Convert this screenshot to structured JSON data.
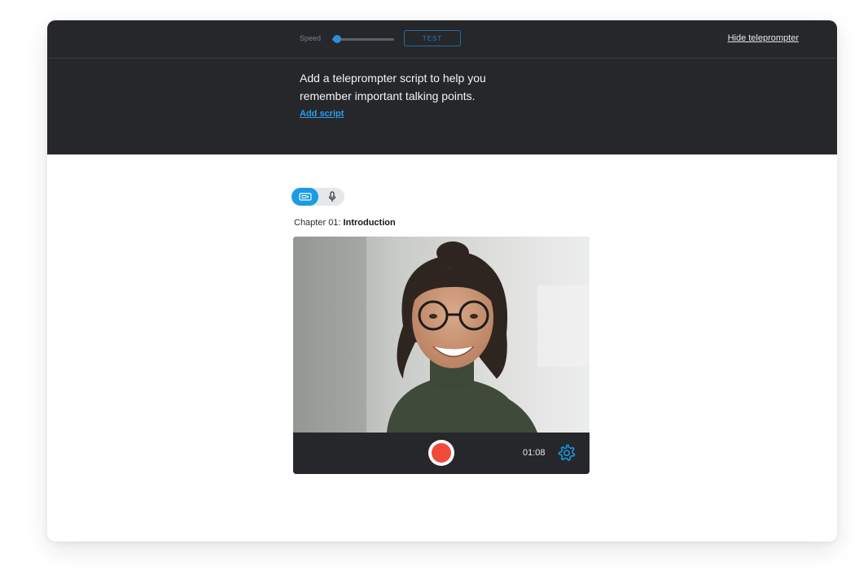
{
  "teleprompter": {
    "speed_label": "Speed",
    "speed_value": 0.05,
    "test_label": "TEST",
    "hide_label": "Hide teleprompter",
    "message_line1": "Add a teleprompter script to help you",
    "message_line2": "remember important talking points.",
    "add_script_label": "Add script"
  },
  "mode_toggle": {
    "selected": "video",
    "options": [
      {
        "name": "video",
        "icon": "video-camera-icon"
      },
      {
        "name": "audio",
        "icon": "microphone-icon"
      }
    ]
  },
  "chapter": {
    "prefix": "Chapter 01:",
    "title": "Introduction"
  },
  "recorder": {
    "timer": "01:08",
    "record_icon": "record-icon",
    "settings_icon": "gear-icon"
  },
  "colors": {
    "accent": "#1a9be6",
    "dark_panel": "#25272b",
    "record": "#f04a3b"
  }
}
